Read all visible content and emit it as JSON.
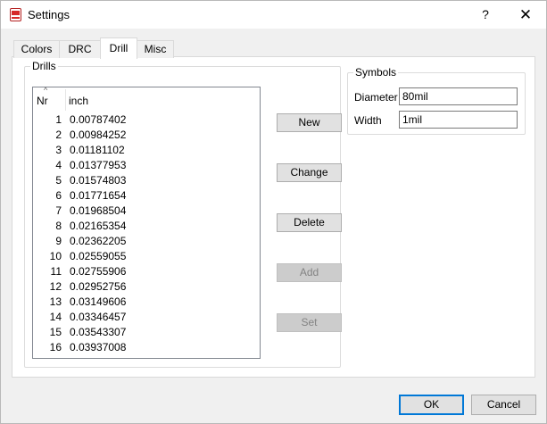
{
  "window": {
    "title": "Settings",
    "help_glyph": "?",
    "close_glyph": "✕"
  },
  "tabs": [
    {
      "label": "Colors",
      "active": false
    },
    {
      "label": "DRC",
      "active": false
    },
    {
      "label": "Drill",
      "active": true
    },
    {
      "label": "Misc",
      "active": false
    }
  ],
  "drills": {
    "group_label": "Drills",
    "columns": {
      "nr": "Nr",
      "inch": "inch"
    },
    "rows": [
      {
        "nr": "1",
        "inch": "0.00787402"
      },
      {
        "nr": "2",
        "inch": "0.00984252"
      },
      {
        "nr": "3",
        "inch": "0.01181102"
      },
      {
        "nr": "4",
        "inch": "0.01377953"
      },
      {
        "nr": "5",
        "inch": "0.01574803"
      },
      {
        "nr": "6",
        "inch": "0.01771654"
      },
      {
        "nr": "7",
        "inch": "0.01968504"
      },
      {
        "nr": "8",
        "inch": "0.02165354"
      },
      {
        "nr": "9",
        "inch": "0.02362205"
      },
      {
        "nr": "10",
        "inch": "0.02559055"
      },
      {
        "nr": "11",
        "inch": "0.02755906"
      },
      {
        "nr": "12",
        "inch": "0.02952756"
      },
      {
        "nr": "13",
        "inch": "0.03149606"
      },
      {
        "nr": "14",
        "inch": "0.03346457"
      },
      {
        "nr": "15",
        "inch": "0.03543307"
      },
      {
        "nr": "16",
        "inch": "0.03937008"
      }
    ],
    "buttons": {
      "new": "New",
      "change": "Change",
      "delete": "Delete",
      "add": "Add",
      "set": "Set"
    }
  },
  "symbols": {
    "group_label": "Symbols",
    "diameter_label": "Diameter",
    "diameter_value": "80mil",
    "width_label": "Width",
    "width_value": "1mil"
  },
  "footer": {
    "ok_label": "OK",
    "cancel_label": "Cancel"
  },
  "colors": {
    "accent": "#0078d7",
    "app_icon": "#d62a2a"
  }
}
